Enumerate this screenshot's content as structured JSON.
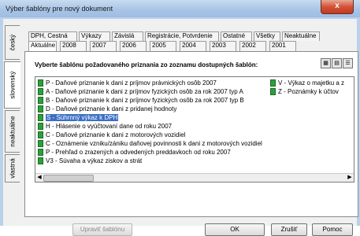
{
  "window": {
    "title": "Výber šablóny pre nový dokument",
    "close_label": "x"
  },
  "vertical_tabs": [
    "český",
    "slovenský",
    "neaktuálne",
    "vlastná"
  ],
  "tabs_row1": [
    "DPH, Cestná",
    "Výkazy",
    "Závislá",
    "Registrácie, Potvrdenie",
    "Ostatné",
    "Všetky",
    "Neaktuálne"
  ],
  "tabs_row2": [
    "Aktuálne",
    "2008",
    "2007",
    "2006",
    "2005",
    "2004",
    "2003",
    "2002",
    "2001"
  ],
  "prompt": "Vyberte šablónu požadovaného priznania zo zoznamu dostupných šablón:",
  "list_col1": [
    "P - Daňové priznanie k dani z príjmov právnických osôb 2007",
    "A - Daňové priznanie k dani z príjmov fyzických osôb za rok 2007 typ A",
    "B - Daňové priznanie k dani z príjmov fyzických osôb za rok 2007 typ B",
    "D - Daňové priznanie k dani z pridanej hodnoty",
    "S - Súhrnný výkaz k DPH",
    "H - Hlásenie o vyúčtovaní dane od roku 2007",
    "C - Daňové priznanie k dani z motorových vozidiel",
    "C - Oznámenie vzniku/zániku daňovej povinnosti k dani z motorových vozidiel",
    "P - Prehľad o zrazených a odvedených preddavkoch od roku 2007",
    "V3 - Súvaha a výkaz ziskov a strát"
  ],
  "list_col2": [
    "V - Výkaz o majetku a z",
    "Z - Poznámky k účtov"
  ],
  "selected_index": 4,
  "buttons": {
    "edit": "Upraviť šablónu",
    "ok": "OK",
    "cancel": "Zrušiť",
    "help": "Pomoc"
  }
}
